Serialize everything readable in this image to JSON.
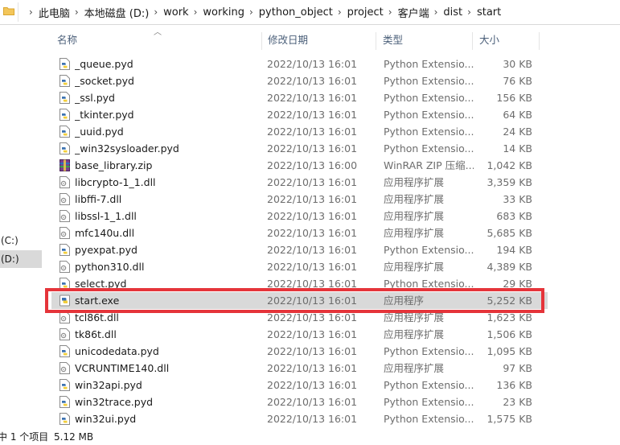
{
  "breadcrumbs": [
    "此电脑",
    "本地磁盘 (D:)",
    "work",
    "working",
    "python_object",
    "project",
    "客户端",
    "dist",
    "start"
  ],
  "nav": {
    "items": [
      "(C:)",
      "(D:)"
    ],
    "selected_index": 1
  },
  "columns": {
    "name": "名称",
    "date": "修改日期",
    "type": "类型",
    "size": "大小"
  },
  "files": [
    {
      "name": "_queue.pyd",
      "date": "2022/10/13 16:01",
      "type": "Python Extensio...",
      "size": "30 KB",
      "icon": "pyd-icon"
    },
    {
      "name": "_socket.pyd",
      "date": "2022/10/13 16:01",
      "type": "Python Extensio...",
      "size": "76 KB",
      "icon": "pyd-icon"
    },
    {
      "name": "_ssl.pyd",
      "date": "2022/10/13 16:01",
      "type": "Python Extensio...",
      "size": "156 KB",
      "icon": "pyd-icon"
    },
    {
      "name": "_tkinter.pyd",
      "date": "2022/10/13 16:01",
      "type": "Python Extensio...",
      "size": "64 KB",
      "icon": "pyd-icon"
    },
    {
      "name": "_uuid.pyd",
      "date": "2022/10/13 16:01",
      "type": "Python Extensio...",
      "size": "24 KB",
      "icon": "pyd-icon"
    },
    {
      "name": "_win32sysloader.pyd",
      "date": "2022/10/13 16:01",
      "type": "Python Extensio...",
      "size": "14 KB",
      "icon": "pyd-icon"
    },
    {
      "name": "base_library.zip",
      "date": "2022/10/13 16:00",
      "type": "WinRAR ZIP 压缩...",
      "size": "1,042 KB",
      "icon": "zip-icon"
    },
    {
      "name": "libcrypto-1_1.dll",
      "date": "2022/10/13 16:01",
      "type": "应用程序扩展",
      "size": "3,359 KB",
      "icon": "dll-icon"
    },
    {
      "name": "libffi-7.dll",
      "date": "2022/10/13 16:01",
      "type": "应用程序扩展",
      "size": "33 KB",
      "icon": "dll-icon"
    },
    {
      "name": "libssl-1_1.dll",
      "date": "2022/10/13 16:01",
      "type": "应用程序扩展",
      "size": "683 KB",
      "icon": "dll-icon"
    },
    {
      "name": "mfc140u.dll",
      "date": "2022/10/13 16:01",
      "type": "应用程序扩展",
      "size": "5,685 KB",
      "icon": "dll-icon"
    },
    {
      "name": "pyexpat.pyd",
      "date": "2022/10/13 16:01",
      "type": "Python Extensio...",
      "size": "194 KB",
      "icon": "pyd-icon"
    },
    {
      "name": "python310.dll",
      "date": "2022/10/13 16:01",
      "type": "应用程序扩展",
      "size": "4,389 KB",
      "icon": "dll-icon"
    },
    {
      "name": "select.pyd",
      "date": "2022/10/13 16:01",
      "type": "Python Extensio...",
      "size": "29 KB",
      "icon": "pyd-icon"
    },
    {
      "name": "start.exe",
      "date": "2022/10/13 16:01",
      "type": "应用程序",
      "size": "5,252 KB",
      "icon": "exe-icon",
      "selected": true
    },
    {
      "name": "tcl86t.dll",
      "date": "2022/10/13 16:01",
      "type": "应用程序扩展",
      "size": "1,623 KB",
      "icon": "dll-icon"
    },
    {
      "name": "tk86t.dll",
      "date": "2022/10/13 16:01",
      "type": "应用程序扩展",
      "size": "1,506 KB",
      "icon": "dll-icon"
    },
    {
      "name": "unicodedata.pyd",
      "date": "2022/10/13 16:01",
      "type": "Python Extensio...",
      "size": "1,095 KB",
      "icon": "pyd-icon"
    },
    {
      "name": "VCRUNTIME140.dll",
      "date": "2022/10/13 16:01",
      "type": "应用程序扩展",
      "size": "97 KB",
      "icon": "dll-icon"
    },
    {
      "name": "win32api.pyd",
      "date": "2022/10/13 16:01",
      "type": "Python Extensio...",
      "size": "136 KB",
      "icon": "pyd-icon"
    },
    {
      "name": "win32trace.pyd",
      "date": "2022/10/13 16:01",
      "type": "Python Extensio...",
      "size": "23 KB",
      "icon": "pyd-icon"
    },
    {
      "name": "win32ui.pyd",
      "date": "2022/10/13 16:01",
      "type": "Python Extensio...",
      "size": "1,575 KB",
      "icon": "pyd-icon"
    }
  ],
  "status": {
    "selection": "中 1 个项目",
    "size": "5.12 MB"
  },
  "colors": {
    "highlight": "#e5343a",
    "selected_row": "#d9d9d9",
    "header_text": "#4c607a"
  }
}
